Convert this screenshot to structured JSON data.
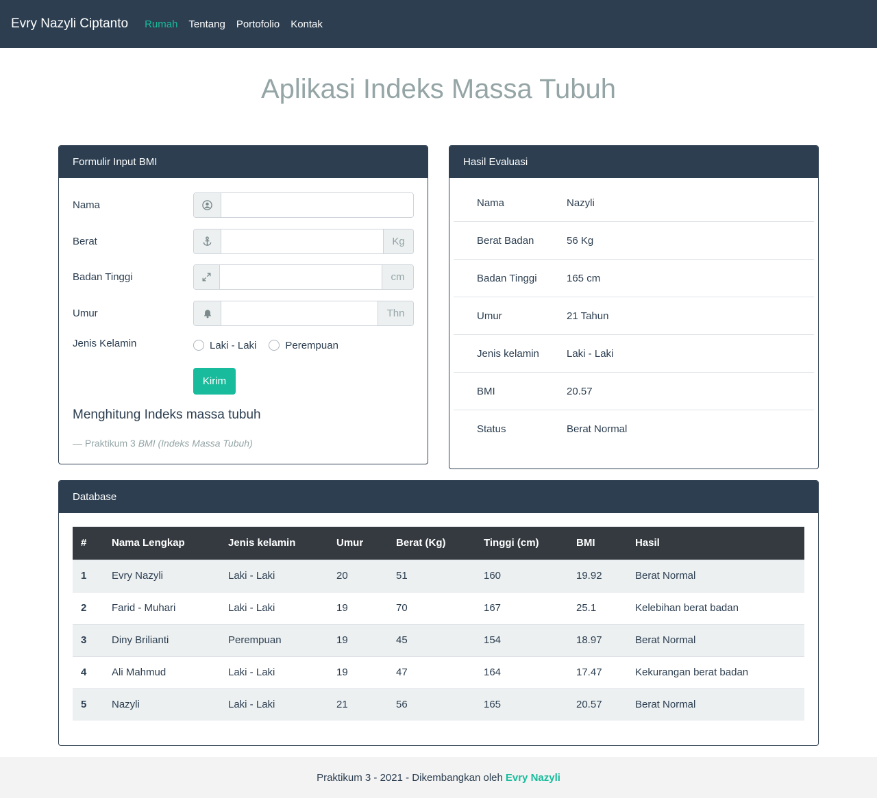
{
  "navbar": {
    "brand": "Evry Nazyli Ciptanto",
    "links": [
      "Rumah",
      "Tentang",
      "Portofolio",
      "Kontak"
    ]
  },
  "title": "Aplikasi Indeks Massa Tubuh",
  "form_card": {
    "header": "Formulir Input BMI",
    "fields": [
      {
        "label": "Nama",
        "icon": "user-circle-icon",
        "value": "",
        "unit": ""
      },
      {
        "label": "Berat",
        "icon": "anchor-icon",
        "value": "",
        "unit": "Kg"
      },
      {
        "label": "Badan Tinggi",
        "icon": "expand-icon",
        "value": "",
        "unit": "cm"
      },
      {
        "label": "Umur",
        "icon": "bell-icon",
        "value": "",
        "unit": "Thn"
      }
    ],
    "gender_label": "Jenis Kelamin",
    "gender_options": [
      "Laki - Laki",
      "Perempuan"
    ],
    "submit": "Kirim",
    "blockquote": "Menghitung Indeks massa tubuh",
    "blockquote_footer_prefix": "— Praktikum 3",
    "blockquote_cite": "BMI (Indeks Massa Tubuh)"
  },
  "result_card": {
    "header": "Hasil Evaluasi",
    "rows": [
      {
        "key": "Nama",
        "value": "Nazyli"
      },
      {
        "key": "Berat Badan",
        "value": "56 Kg"
      },
      {
        "key": "Badan Tinggi",
        "value": "165 cm"
      },
      {
        "key": "Umur",
        "value": "21 Tahun"
      },
      {
        "key": "Jenis kelamin",
        "value": "Laki - Laki"
      },
      {
        "key": "BMI",
        "value": "20.57"
      },
      {
        "key": "Status",
        "value": "Berat Normal"
      }
    ]
  },
  "db_card": {
    "header": "Database",
    "columns": [
      "#",
      "Nama Lengkap",
      "Jenis kelamin",
      "Umur",
      "Berat (Kg)",
      "Tinggi (cm)",
      "BMI",
      "Hasil"
    ],
    "rows": [
      [
        "1",
        "Evry Nazyli",
        "Laki - Laki",
        "20",
        "51",
        "160",
        "19.92",
        "Berat Normal"
      ],
      [
        "2",
        "Farid - Muhari",
        "Laki - Laki",
        "19",
        "70",
        "167",
        "25.1",
        "Kelebihan berat badan"
      ],
      [
        "3",
        "Diny Brilianti",
        "Perempuan",
        "19",
        "45",
        "154",
        "18.97",
        "Berat Normal"
      ],
      [
        "4",
        "Ali Mahmud",
        "Laki - Laki",
        "19",
        "47",
        "164",
        "17.47",
        "Kekurangan berat badan"
      ],
      [
        "5",
        "Nazyli",
        "Laki - Laki",
        "21",
        "56",
        "165",
        "20.57",
        "Berat Normal"
      ]
    ]
  },
  "footer": {
    "text": "Praktikum 3 - 2021 - Dikembangkan oleh",
    "author": "Evry Nazyli"
  },
  "colors": {
    "navbar": "#2c3e50",
    "accent": "#18bc9c",
    "title": "#95a5a6"
  }
}
